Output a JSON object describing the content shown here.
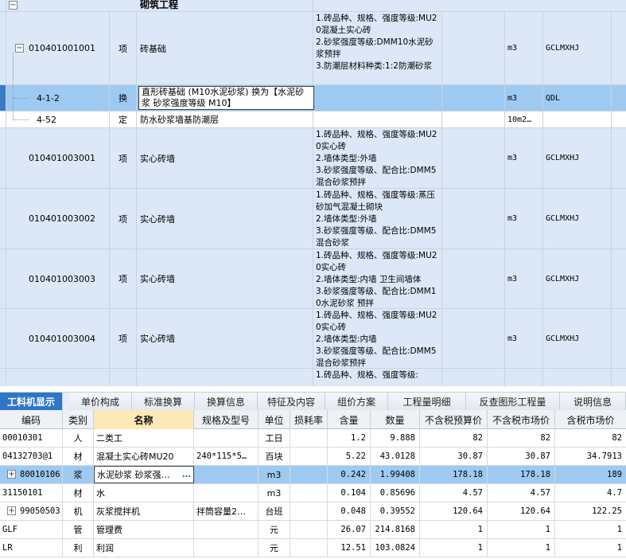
{
  "section": {
    "collapse_symbol": "−",
    "title": "砌筑工程"
  },
  "items": [
    {
      "code": "010401001001",
      "type": "项",
      "name": "砖基础",
      "features": "1.砖品种、规格、强度等级:MU20混凝土实心砖\n2.砂浆强度等级:DMM10水泥砂浆预拌\n3.防潮层材料种类:1:2防潮砂浆",
      "unit": "m3",
      "expr": "GCLMXHJ",
      "collapse_symbol": "−",
      "children": [
        {
          "code": "4-1-2",
          "type": "换",
          "name": "直形砖基础 (M10水泥砂浆)   换为【水泥砂浆 砂浆强度等级 M10】",
          "unit": "m3",
          "expr": "QDL"
        },
        {
          "code": "4-52",
          "type": "定",
          "name": "防水砂浆墙基防潮层",
          "unit": "10m2…",
          "expr": ""
        }
      ]
    },
    {
      "code": "010401003001",
      "type": "项",
      "name": "实心砖墙",
      "features": "1.砖品种、规格、强度等级:MU20实心砖\n2.墙体类型:外墙\n3.砂浆强度等级、配合比:DMM5混合砂浆预拌",
      "unit": "m3",
      "expr": "GCLMXHJ"
    },
    {
      "code": "010401003002",
      "type": "项",
      "name": "实心砖墙",
      "features": "1.砖品种、规格、强度等级:蒸压砂加气混凝土砌块\n2.墙体类型:外墙\n3.砂浆强度等级、配合比:DMM5混合砂浆",
      "unit": "m3",
      "expr": "GCLMXHJ"
    },
    {
      "code": "010401003003",
      "type": "项",
      "name": "实心砖墙",
      "features": "1.砖品种、规格、强度等级:MU20实心砖\n2.墙体类型:内墙 卫生间墙体\n3.砂浆强度等级、配合比:DMM10水泥砂浆 预拌",
      "unit": "m3",
      "expr": "GCLMXHJ"
    },
    {
      "code": "010401003004",
      "type": "项",
      "name": "实心砖墙",
      "features": "1.砖品种、规格、强度等级:MU20实心砖\n2.墙体类型:内墙\n3.砂浆强度等级、配合比:DMM5混合砂浆预拌",
      "unit": "m3",
      "expr": "GCLMXHJ"
    },
    {
      "code": "",
      "type": "",
      "name": "",
      "features": "1.砖品种、规格、强度等级:",
      "unit": "",
      "expr": ""
    }
  ],
  "tabs": [
    "工料机显示",
    "单价构成",
    "标准换算",
    "换算信息",
    "特征及内容",
    "组价方案",
    "工程量明细",
    "反查图形工程量",
    "说明信息"
  ],
  "material_table": {
    "headers": [
      "编码",
      "类别",
      "名称",
      "规格及型号",
      "单位",
      "损耗率",
      "含量",
      "数量",
      "不含税预算价",
      "不含税市场价",
      "含税市场价"
    ],
    "rows": [
      {
        "code": "00010301",
        "cat": "人",
        "name": "二类工",
        "spec": "",
        "unit": "工日",
        "loss": "",
        "content": "1.2",
        "qty": "9.888",
        "budget": "82",
        "market": "82",
        "market_tax": "82"
      },
      {
        "code": "04132703@1",
        "cat": "材",
        "name": "混凝土实心砖MU20",
        "spec": "240*115*5…",
        "unit": "百块",
        "loss": "",
        "content": "5.22",
        "qty": "43.0128",
        "budget": "30.87",
        "market": "30.87",
        "market_tax": "34.7913"
      },
      {
        "code": "80010106",
        "cat": "浆",
        "name": "水泥砂浆 砂浆强…",
        "spec": "",
        "unit": "m3",
        "loss": "",
        "content": "0.242",
        "qty": "1.99408",
        "budget": "178.18",
        "market": "178.18",
        "market_tax": "189",
        "expand": "+"
      },
      {
        "code": "31150101",
        "cat": "材",
        "name": "水",
        "spec": "",
        "unit": "m3",
        "loss": "",
        "content": "0.104",
        "qty": "0.85696",
        "budget": "4.57",
        "market": "4.57",
        "market_tax": "4.7"
      },
      {
        "code": "99050503",
        "cat": "机",
        "name": "灰浆搅拌机",
        "spec": "拌筒容量2…",
        "unit": "台班",
        "loss": "",
        "content": "0.048",
        "qty": "0.39552",
        "budget": "120.64",
        "market": "120.64",
        "market_tax": "122.25",
        "expand": "+"
      },
      {
        "code": "GLF",
        "cat": "管",
        "name": "管理费",
        "spec": "",
        "unit": "元",
        "loss": "",
        "content": "26.07",
        "qty": "214.8168",
        "budget": "1",
        "market": "1",
        "market_tax": "1"
      },
      {
        "code": "LR",
        "cat": "利",
        "name": "利润",
        "spec": "",
        "unit": "元",
        "loss": "",
        "content": "12.51",
        "qty": "103.0824",
        "budget": "1",
        "market": "1",
        "market_tax": "1"
      }
    ],
    "edit_dots": "…"
  }
}
